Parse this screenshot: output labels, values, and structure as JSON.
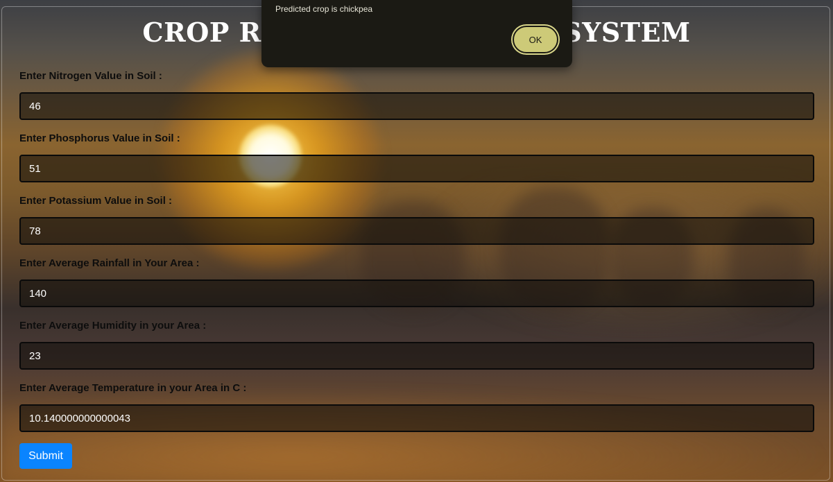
{
  "page": {
    "title": "CROP RECOMMENDATION SYSTEM"
  },
  "form": {
    "fields": [
      {
        "label": "Enter Nitrogen Value in Soil :",
        "value": "46"
      },
      {
        "label": "Enter Phosphorus Value in Soil :",
        "value": "51"
      },
      {
        "label": "Enter Potassium Value in Soil :",
        "value": "78"
      },
      {
        "label": "Enter Average Rainfall in Your Area :",
        "value": "140"
      },
      {
        "label": "Enter Average Humidity in your Area :",
        "value": "23"
      },
      {
        "label": "Enter Average Temperature in your Area in C :",
        "value": "10.140000000000043"
      }
    ],
    "submit_label": "Submit"
  },
  "dialog": {
    "message": "Predicted crop is chickpea",
    "ok_label": "OK"
  },
  "colors": {
    "submit_button": "#0a84ff",
    "dialog_background": "#1b1a14",
    "ok_button": "#cdca78"
  }
}
